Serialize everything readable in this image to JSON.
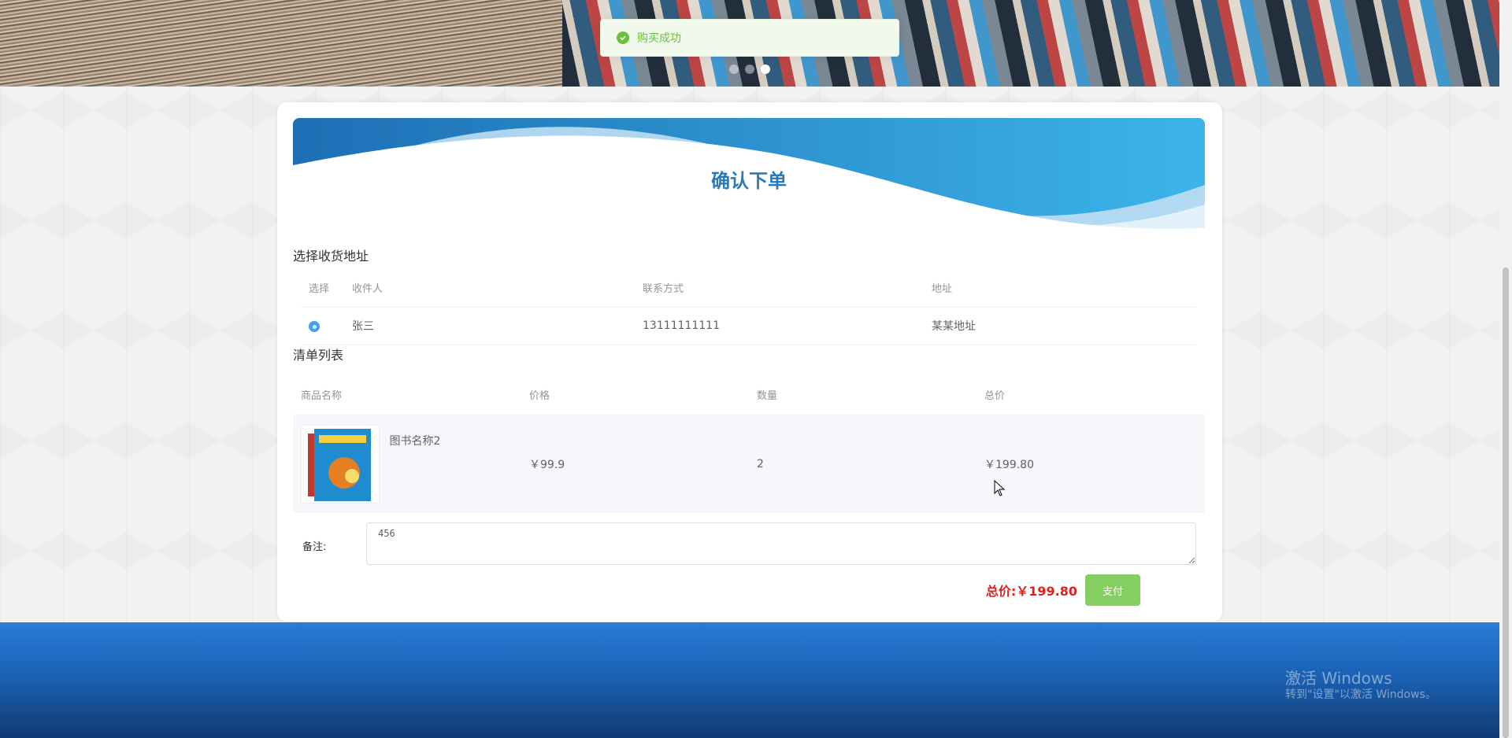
{
  "toast": {
    "message": "购买成功",
    "icon": "check-circle-icon"
  },
  "banner": {
    "dots": 3,
    "active_dot": 3
  },
  "order": {
    "title": "确认下单",
    "address_section_title": "选择收货地址",
    "address_table": {
      "headers": [
        "选择",
        "收件人",
        "联系方式",
        "地址"
      ],
      "rows": [
        {
          "selected": true,
          "recipient": "张三",
          "phone": "13111111111",
          "address": "某某地址"
        }
      ]
    },
    "items_section_title": "清单列表",
    "items_table": {
      "headers": [
        "商品名称",
        "价格",
        "数量",
        "总价"
      ],
      "rows": [
        {
          "name": "图书名称2",
          "price": "￥99.9",
          "quantity": "2",
          "total": "￥199.80"
        }
      ]
    },
    "remark_label": "备注:",
    "remark_value": "456",
    "total_label": "总价:￥199.80",
    "pay_button": "支付"
  },
  "colors": {
    "accent_blue": "#2b7ab8",
    "success_green": "#67c23a",
    "total_red": "#e02020",
    "pay_button": "#85ce61",
    "footer_blue": "#1a5fb0"
  },
  "watermark": {
    "title": "激活 Windows",
    "subtitle": "转到\"设置\"以激活 Windows。"
  }
}
